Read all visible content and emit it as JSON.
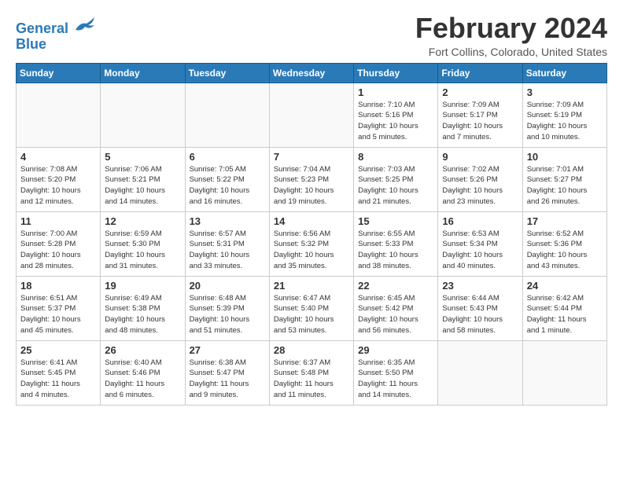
{
  "header": {
    "logo_line1": "General",
    "logo_line2": "Blue",
    "month_title": "February 2024",
    "location": "Fort Collins, Colorado, United States"
  },
  "weekdays": [
    "Sunday",
    "Monday",
    "Tuesday",
    "Wednesday",
    "Thursday",
    "Friday",
    "Saturday"
  ],
  "weeks": [
    [
      {
        "day": "",
        "info": ""
      },
      {
        "day": "",
        "info": ""
      },
      {
        "day": "",
        "info": ""
      },
      {
        "day": "",
        "info": ""
      },
      {
        "day": "1",
        "info": "Sunrise: 7:10 AM\nSunset: 5:16 PM\nDaylight: 10 hours\nand 5 minutes."
      },
      {
        "day": "2",
        "info": "Sunrise: 7:09 AM\nSunset: 5:17 PM\nDaylight: 10 hours\nand 7 minutes."
      },
      {
        "day": "3",
        "info": "Sunrise: 7:09 AM\nSunset: 5:19 PM\nDaylight: 10 hours\nand 10 minutes."
      }
    ],
    [
      {
        "day": "4",
        "info": "Sunrise: 7:08 AM\nSunset: 5:20 PM\nDaylight: 10 hours\nand 12 minutes."
      },
      {
        "day": "5",
        "info": "Sunrise: 7:06 AM\nSunset: 5:21 PM\nDaylight: 10 hours\nand 14 minutes."
      },
      {
        "day": "6",
        "info": "Sunrise: 7:05 AM\nSunset: 5:22 PM\nDaylight: 10 hours\nand 16 minutes."
      },
      {
        "day": "7",
        "info": "Sunrise: 7:04 AM\nSunset: 5:23 PM\nDaylight: 10 hours\nand 19 minutes."
      },
      {
        "day": "8",
        "info": "Sunrise: 7:03 AM\nSunset: 5:25 PM\nDaylight: 10 hours\nand 21 minutes."
      },
      {
        "day": "9",
        "info": "Sunrise: 7:02 AM\nSunset: 5:26 PM\nDaylight: 10 hours\nand 23 minutes."
      },
      {
        "day": "10",
        "info": "Sunrise: 7:01 AM\nSunset: 5:27 PM\nDaylight: 10 hours\nand 26 minutes."
      }
    ],
    [
      {
        "day": "11",
        "info": "Sunrise: 7:00 AM\nSunset: 5:28 PM\nDaylight: 10 hours\nand 28 minutes."
      },
      {
        "day": "12",
        "info": "Sunrise: 6:59 AM\nSunset: 5:30 PM\nDaylight: 10 hours\nand 31 minutes."
      },
      {
        "day": "13",
        "info": "Sunrise: 6:57 AM\nSunset: 5:31 PM\nDaylight: 10 hours\nand 33 minutes."
      },
      {
        "day": "14",
        "info": "Sunrise: 6:56 AM\nSunset: 5:32 PM\nDaylight: 10 hours\nand 35 minutes."
      },
      {
        "day": "15",
        "info": "Sunrise: 6:55 AM\nSunset: 5:33 PM\nDaylight: 10 hours\nand 38 minutes."
      },
      {
        "day": "16",
        "info": "Sunrise: 6:53 AM\nSunset: 5:34 PM\nDaylight: 10 hours\nand 40 minutes."
      },
      {
        "day": "17",
        "info": "Sunrise: 6:52 AM\nSunset: 5:36 PM\nDaylight: 10 hours\nand 43 minutes."
      }
    ],
    [
      {
        "day": "18",
        "info": "Sunrise: 6:51 AM\nSunset: 5:37 PM\nDaylight: 10 hours\nand 45 minutes."
      },
      {
        "day": "19",
        "info": "Sunrise: 6:49 AM\nSunset: 5:38 PM\nDaylight: 10 hours\nand 48 minutes."
      },
      {
        "day": "20",
        "info": "Sunrise: 6:48 AM\nSunset: 5:39 PM\nDaylight: 10 hours\nand 51 minutes."
      },
      {
        "day": "21",
        "info": "Sunrise: 6:47 AM\nSunset: 5:40 PM\nDaylight: 10 hours\nand 53 minutes."
      },
      {
        "day": "22",
        "info": "Sunrise: 6:45 AM\nSunset: 5:42 PM\nDaylight: 10 hours\nand 56 minutes."
      },
      {
        "day": "23",
        "info": "Sunrise: 6:44 AM\nSunset: 5:43 PM\nDaylight: 10 hours\nand 58 minutes."
      },
      {
        "day": "24",
        "info": "Sunrise: 6:42 AM\nSunset: 5:44 PM\nDaylight: 11 hours\nand 1 minute."
      }
    ],
    [
      {
        "day": "25",
        "info": "Sunrise: 6:41 AM\nSunset: 5:45 PM\nDaylight: 11 hours\nand 4 minutes."
      },
      {
        "day": "26",
        "info": "Sunrise: 6:40 AM\nSunset: 5:46 PM\nDaylight: 11 hours\nand 6 minutes."
      },
      {
        "day": "27",
        "info": "Sunrise: 6:38 AM\nSunset: 5:47 PM\nDaylight: 11 hours\nand 9 minutes."
      },
      {
        "day": "28",
        "info": "Sunrise: 6:37 AM\nSunset: 5:48 PM\nDaylight: 11 hours\nand 11 minutes."
      },
      {
        "day": "29",
        "info": "Sunrise: 6:35 AM\nSunset: 5:50 PM\nDaylight: 11 hours\nand 14 minutes."
      },
      {
        "day": "",
        "info": ""
      },
      {
        "day": "",
        "info": ""
      }
    ]
  ]
}
